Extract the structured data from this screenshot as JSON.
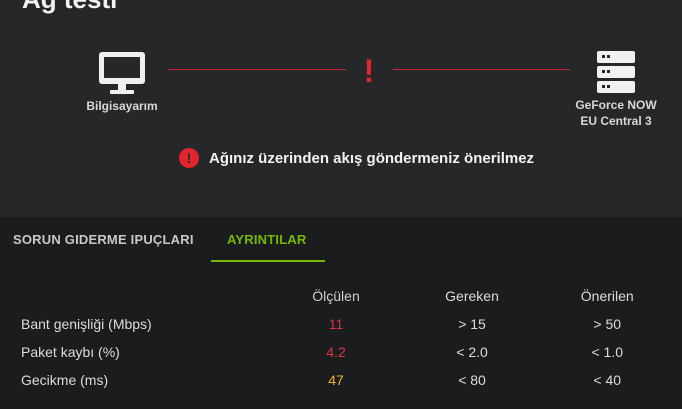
{
  "page": {
    "title": "Ağ testi"
  },
  "connection": {
    "client_label": "Bilgisayarım",
    "server_label_line1": "GeForce NOW",
    "server_label_line2": "EU Central 3",
    "status_glyph": "!",
    "line_color": "#c9262e"
  },
  "warning": {
    "text": "Ağınız üzerinden akış göndermeniz önerilmez",
    "icon": "alert-circle-icon",
    "color": "#e1252e"
  },
  "tabs": [
    {
      "label": "SORUN GIDERME IPUÇLARI",
      "active": false
    },
    {
      "label": "AYRINTILAR",
      "active": true
    }
  ],
  "accent": "#76b900",
  "metrics": {
    "headers": {
      "measured": "Ölçülen",
      "required": "Gereken",
      "recommended": "Önerilen"
    },
    "rows": [
      {
        "label": "Bant genişliği (Mbps)",
        "measured": "11",
        "required": "> 15",
        "recommended": "> 50",
        "status": "bad"
      },
      {
        "label": "Paket kaybı (%)",
        "measured": "4.2",
        "required": "< 2.0",
        "recommended": "< 1.0",
        "status": "bad"
      },
      {
        "label": "Gecikme (ms)",
        "measured": "47",
        "required": "< 80",
        "recommended": "< 40",
        "status": "ok"
      }
    ]
  }
}
